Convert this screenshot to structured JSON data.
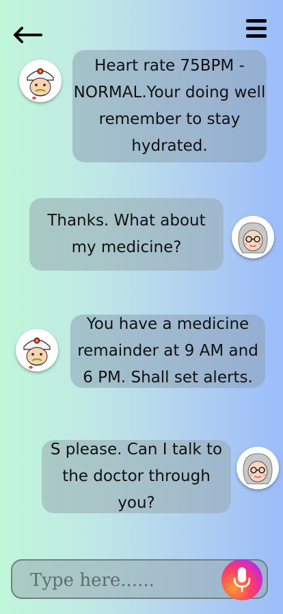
{
  "header": {
    "back_icon": "back-arrow-icon",
    "menu_icon": "hamburger-menu-icon"
  },
  "messages": [
    {
      "sender": "bot",
      "avatar": "doctor-avatar",
      "text": "Heart rate 75BPM - NORMAL.Your doing well remember to stay hydrated."
    },
    {
      "sender": "user",
      "avatar": "grandma-avatar",
      "text": "Thanks. What about my medicine?"
    },
    {
      "sender": "bot",
      "avatar": "doctor-avatar",
      "text": "You have a medicine remainder at 9 AM and 6 PM. Shall set alerts."
    },
    {
      "sender": "user",
      "avatar": "grandma-avatar",
      "text": "S please. Can I talk to the doctor through you?"
    }
  ],
  "composer": {
    "placeholder": "Type here......",
    "mic_icon": "microphone-icon"
  }
}
